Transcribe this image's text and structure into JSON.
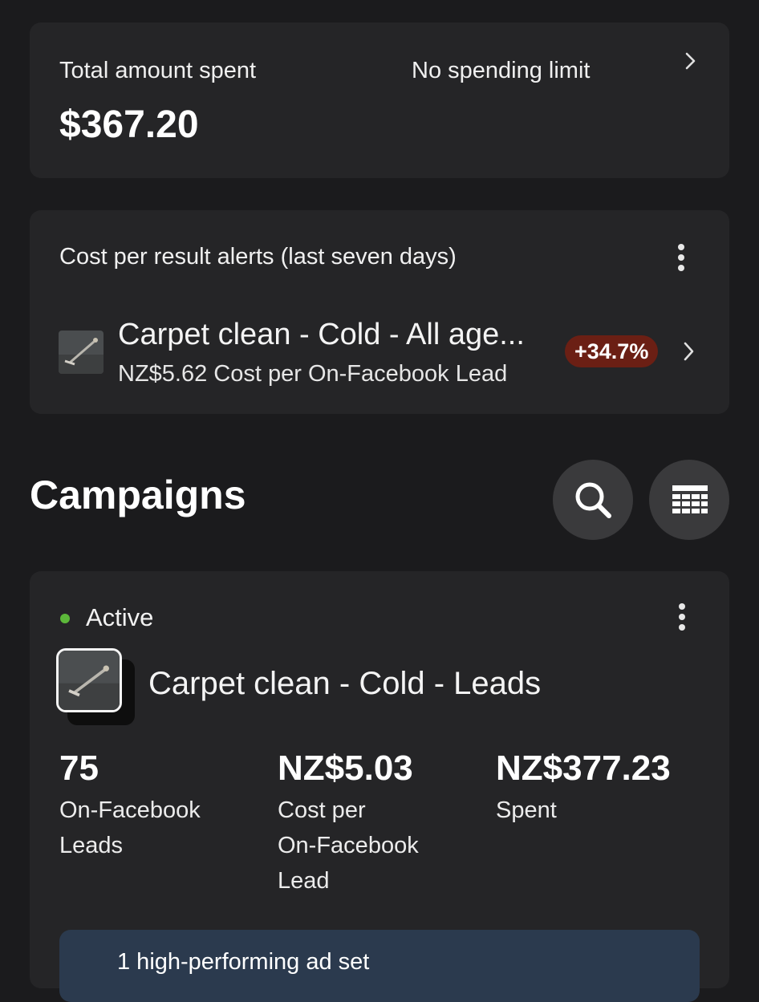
{
  "spend": {
    "label": "Total amount spent",
    "amount": "$367.20",
    "limit": "No spending limit"
  },
  "alerts": {
    "title": "Cost per result alerts (last seven days)",
    "item": {
      "name": "Carpet clean - Cold - All age...",
      "detail": "NZ$5.62 Cost per On-Facebook Lead",
      "change": "+34.7%",
      "change_color": "#6b1f14"
    }
  },
  "campaigns": {
    "title": "Campaigns",
    "search_icon": "search-icon",
    "table_icon": "table-icon"
  },
  "campaign": {
    "status": "Active",
    "status_color": "#5cb83a",
    "name": "Carpet clean - Cold - Leads",
    "metrics": {
      "leads": {
        "value": "75",
        "label_1": "On-Facebook",
        "label_2": "Leads"
      },
      "cpl": {
        "value": "NZ$5.03",
        "label_1": "Cost per",
        "label_2": "On-Facebook",
        "label_3": "Lead"
      },
      "spent": {
        "value": "NZ$377.23",
        "label_1": "Spent"
      }
    },
    "banner": "1 high-performing ad set"
  }
}
